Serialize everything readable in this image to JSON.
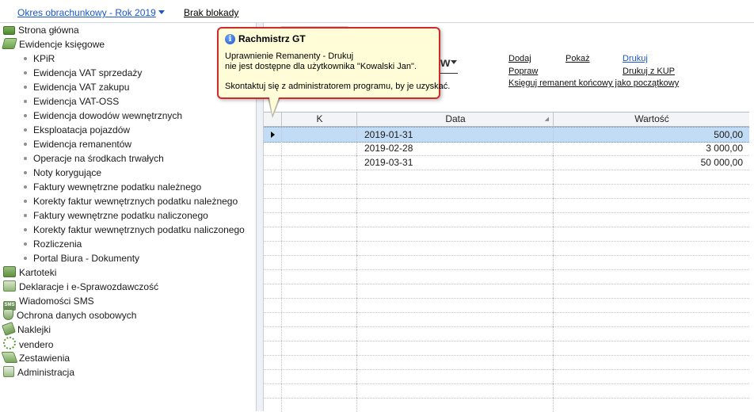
{
  "topbar": {
    "period_label": "Okres obrachunkowy - Rok 2019",
    "blocks_label": "Brak blokady"
  },
  "sidebar": {
    "items": [
      {
        "label": "Strona główna",
        "icon": "money-icon"
      },
      {
        "label": "Ewidencje księgowe",
        "icon": "book-icon"
      },
      {
        "label": "KPiR"
      },
      {
        "label": "Ewidencja VAT sprzedaży"
      },
      {
        "label": "Ewidencja VAT zakupu"
      },
      {
        "label": "Ewidencja VAT-OSS"
      },
      {
        "label": "Ewidencja dowodów wewnętrznych"
      },
      {
        "label": "Eksploatacja pojazdów"
      },
      {
        "label": "Ewidencja remanentów"
      },
      {
        "label": "Operacje na środkach trwałych"
      },
      {
        "label": "Noty korygujące"
      },
      {
        "label": "Faktury wewnętrzne podatku należnego"
      },
      {
        "label": "Korekty faktur wewnętrznych podatku należnego"
      },
      {
        "label": "Faktury wewnętrzne podatku naliczonego"
      },
      {
        "label": "Korekty faktur wewnętrznych podatku naliczonego"
      },
      {
        "label": "Rozliczenia"
      },
      {
        "label": "Portal Biura - Dokumenty"
      },
      {
        "label": "Kartoteki",
        "icon": "cards-icon"
      },
      {
        "label": "Deklaracje i e-Sprawozdawczość",
        "icon": "documents-icon"
      },
      {
        "label": "Wiadomości SMS",
        "icon": "sms-icon"
      },
      {
        "label": "Ochrona danych osobowych",
        "icon": "shield-icon"
      },
      {
        "label": "Naklejki",
        "icon": "tag-icon"
      },
      {
        "label": "vendero",
        "icon": "recycle-icon"
      },
      {
        "label": "Zestawienia",
        "icon": "stack-icon"
      },
      {
        "label": "Administracja",
        "icon": "admin-icon"
      }
    ]
  },
  "main": {
    "heading_tail": "w",
    "actions": {
      "dodaj": "Dodaj",
      "pokaz": "Pokaż",
      "drukuj": "Drukuj",
      "popraw": "Popraw",
      "drukuj_kup": "Drukuj z KUP",
      "ksieguj": "Księguj remanent końcowy jako początkowy"
    },
    "grid": {
      "columns": [
        "K",
        "Data",
        "Wartość"
      ],
      "rows": [
        {
          "k": "",
          "date": "2019-01-31",
          "value": "500,00",
          "selected": true
        },
        {
          "k": "",
          "date": "2019-02-28",
          "value": "3 000,00"
        },
        {
          "k": "",
          "date": "2019-03-31",
          "value": "50 000,00"
        }
      ]
    }
  },
  "tooltip": {
    "title": "Rachmistrz GT",
    "line1": "Uprawnienie Remanenty - Drukuj",
    "line2": "nie jest dostępne dla użytkownika \"Kowalski Jan\".",
    "line3": "Skontaktuj się z administratorem programu, by je uzyskać."
  },
  "colors": {
    "link_blue": "#1a57c9",
    "tooltip_border": "#d12a2a",
    "tooltip_bg": "#fffdd8",
    "selected_row": "#c3dcf5"
  }
}
